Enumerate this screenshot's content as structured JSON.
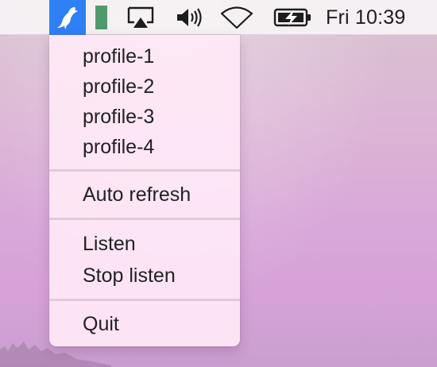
{
  "menubar": {
    "app_icon": "bird-app-icon",
    "status_icons": [
      "green-bar-icon",
      "airplay-icon",
      "volume-icon",
      "wifi-icon",
      "battery-charging-icon"
    ],
    "clock": "Fri 10:39"
  },
  "menu": {
    "items": [
      {
        "label": "profile-1"
      },
      {
        "label": "profile-2"
      },
      {
        "label": "profile-3"
      },
      {
        "label": "profile-4"
      },
      {
        "label": "Auto refresh"
      },
      {
        "label": "Listen"
      },
      {
        "label": "Stop listen"
      },
      {
        "label": "Quit"
      }
    ]
  },
  "colors": {
    "app_highlight": "#2f7ff5",
    "green_indicator": "#4f9a6b"
  }
}
